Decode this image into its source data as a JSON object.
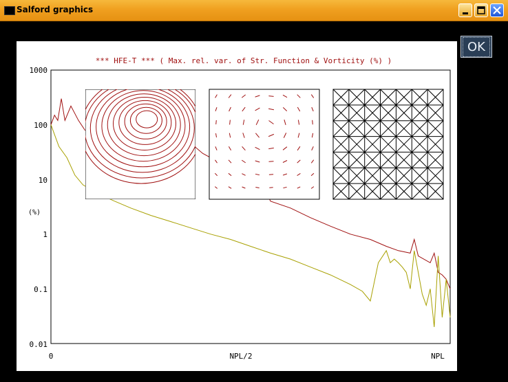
{
  "window": {
    "title": "Salford graphics",
    "ok_label": "OK"
  },
  "chart_data": {
    "type": "line",
    "title": "*** HFE-T *** ( Max. rel. var. of Str. Function & Vorticity (%) )",
    "ylabel": "(%)",
    "xlabel": "",
    "y_scale": "log",
    "ylim": [
      0.01,
      1000
    ],
    "y_tick_labels": [
      "1000",
      "100",
      "10",
      "1",
      "0.1",
      "0.01"
    ],
    "x_tick_labels": [
      "0",
      "NPL/2",
      "NPL"
    ],
    "xlim": [
      0,
      1
    ],
    "grid": false,
    "colors": {
      "series_1": "#a01010",
      "series_2": "#a8a000",
      "title": "#a01010"
    },
    "series": [
      {
        "points": [
          [
            0.0,
            100
          ],
          [
            0.009,
            150
          ],
          [
            0.017,
            120
          ],
          [
            0.026,
            300
          ],
          [
            0.035,
            120
          ],
          [
            0.05,
            220
          ],
          [
            0.069,
            120
          ],
          [
            0.085,
            80
          ],
          [
            0.11,
            60
          ],
          [
            0.14,
            40
          ],
          [
            0.17,
            30
          ],
          [
            0.2,
            25
          ],
          [
            0.23,
            20
          ],
          [
            0.26,
            18
          ],
          [
            0.28,
            50
          ],
          [
            0.3,
            70
          ],
          [
            0.32,
            50
          ],
          [
            0.34,
            45
          ],
          [
            0.36,
            40
          ],
          [
            0.38,
            30
          ],
          [
            0.4,
            25
          ],
          [
            0.42,
            15
          ],
          [
            0.44,
            12
          ],
          [
            0.46,
            11
          ],
          [
            0.48,
            10
          ],
          [
            0.5,
            9.5
          ],
          [
            0.53,
            8
          ],
          [
            0.55,
            4
          ],
          [
            0.6,
            3
          ],
          [
            0.65,
            2
          ],
          [
            0.7,
            1.4
          ],
          [
            0.75,
            1.0
          ],
          [
            0.8,
            0.8
          ],
          [
            0.84,
            0.6
          ],
          [
            0.87,
            0.5
          ],
          [
            0.9,
            0.45
          ],
          [
            0.91,
            0.8
          ],
          [
            0.92,
            0.4
          ],
          [
            0.95,
            0.3
          ],
          [
            0.96,
            0.45
          ],
          [
            0.97,
            0.2
          ],
          [
            0.98,
            0.18
          ],
          [
            0.99,
            0.15
          ],
          [
            1.0,
            0.1
          ]
        ]
      },
      {
        "points": [
          [
            0.0,
            100
          ],
          [
            0.02,
            40
          ],
          [
            0.04,
            25
          ],
          [
            0.06,
            12
          ],
          [
            0.08,
            8
          ],
          [
            0.1,
            6.5
          ],
          [
            0.13,
            5
          ],
          [
            0.16,
            4
          ],
          [
            0.2,
            3
          ],
          [
            0.25,
            2.2
          ],
          [
            0.3,
            1.7
          ],
          [
            0.35,
            1.3
          ],
          [
            0.4,
            1.0
          ],
          [
            0.45,
            0.8
          ],
          [
            0.5,
            0.6
          ],
          [
            0.55,
            0.45
          ],
          [
            0.6,
            0.35
          ],
          [
            0.65,
            0.25
          ],
          [
            0.7,
            0.18
          ],
          [
            0.75,
            0.12
          ],
          [
            0.78,
            0.09
          ],
          [
            0.8,
            0.06
          ],
          [
            0.82,
            0.3
          ],
          [
            0.84,
            0.5
          ],
          [
            0.85,
            0.3
          ],
          [
            0.86,
            0.35
          ],
          [
            0.87,
            0.3
          ],
          [
            0.88,
            0.25
          ],
          [
            0.89,
            0.2
          ],
          [
            0.9,
            0.1
          ],
          [
            0.91,
            0.5
          ],
          [
            0.92,
            0.2
          ],
          [
            0.93,
            0.08
          ],
          [
            0.94,
            0.05
          ],
          [
            0.95,
            0.1
          ],
          [
            0.96,
            0.02
          ],
          [
            0.97,
            0.4
          ],
          [
            0.98,
            0.03
          ],
          [
            0.99,
            0.15
          ],
          [
            1.0,
            0.03
          ]
        ]
      }
    ],
    "insets": [
      {
        "kind": "streamline-contours",
        "color": "#a01010"
      },
      {
        "kind": "vorticity-vectors",
        "color": "#a01010"
      },
      {
        "kind": "triangular-mesh",
        "color": "#000000",
        "divisions": 7
      }
    ]
  }
}
